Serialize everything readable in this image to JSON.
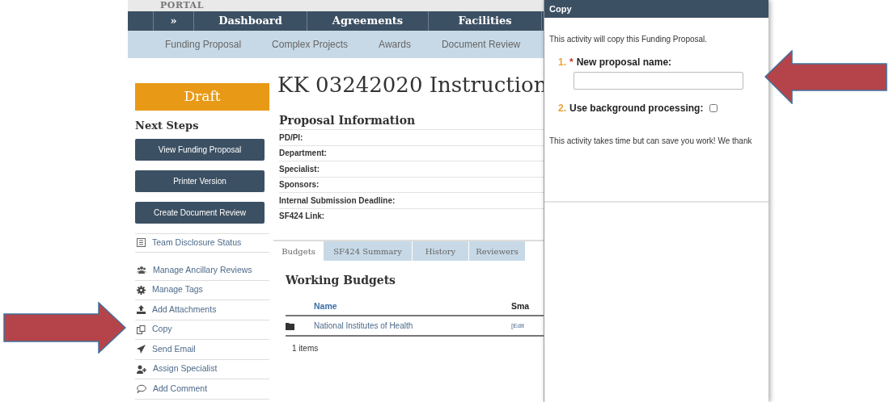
{
  "header": {
    "title": "PORTAL"
  },
  "nav": [
    {
      "label": "»"
    },
    {
      "label": "Dashboard"
    },
    {
      "label": "Agreements"
    },
    {
      "label": "Facilities"
    }
  ],
  "subnav": [
    "Funding Proposal",
    "Complex Projects",
    "Awards",
    "Document Review"
  ],
  "state_badge": "Draft",
  "next_steps": {
    "title": "Next Steps",
    "buttons": [
      "View Funding Proposal",
      "Printer Version",
      "Create Document Review"
    ]
  },
  "activities": [
    "Team Disclosure Status",
    "Manage Ancillary Reviews",
    "Manage Tags",
    "Add Attachments",
    "Copy",
    "Send Email",
    "Assign Specialist",
    "Add Comment"
  ],
  "title": "KK 03242020 Instruction",
  "proposal_info": {
    "heading": "Proposal Information",
    "fields": [
      "PD/PI:",
      "Department:",
      "Specialist:",
      "Sponsors:",
      "Internal Submission Deadline:",
      "SF424 Link:"
    ]
  },
  "tabs": [
    {
      "label": "Budgets",
      "selected": true
    },
    {
      "label": "SF424 Summary",
      "selected": false
    },
    {
      "label": "History",
      "selected": false
    },
    {
      "label": "Reviewers",
      "selected": false
    }
  ],
  "budgets": {
    "heading": "Working Budgets",
    "columns": [
      "Name",
      "Sma"
    ],
    "rows": [
      {
        "name": "National Institutes of Health",
        "column_2": "[Edit"
      }
    ],
    "footer": "1 items"
  },
  "dialog": {
    "title": "Copy",
    "required_mark": "*",
    "intro": "This activity will copy this Funding Proposal.",
    "fields": [
      {
        "kind": "text",
        "number": "1.",
        "required": true,
        "label": "New proposal name:"
      },
      {
        "kind": "checkbox",
        "number": "2.",
        "required": false,
        "label": "Use background processing:",
        "checked": false
      }
    ],
    "note": "This activity takes time but can save you work! We thank"
  }
}
